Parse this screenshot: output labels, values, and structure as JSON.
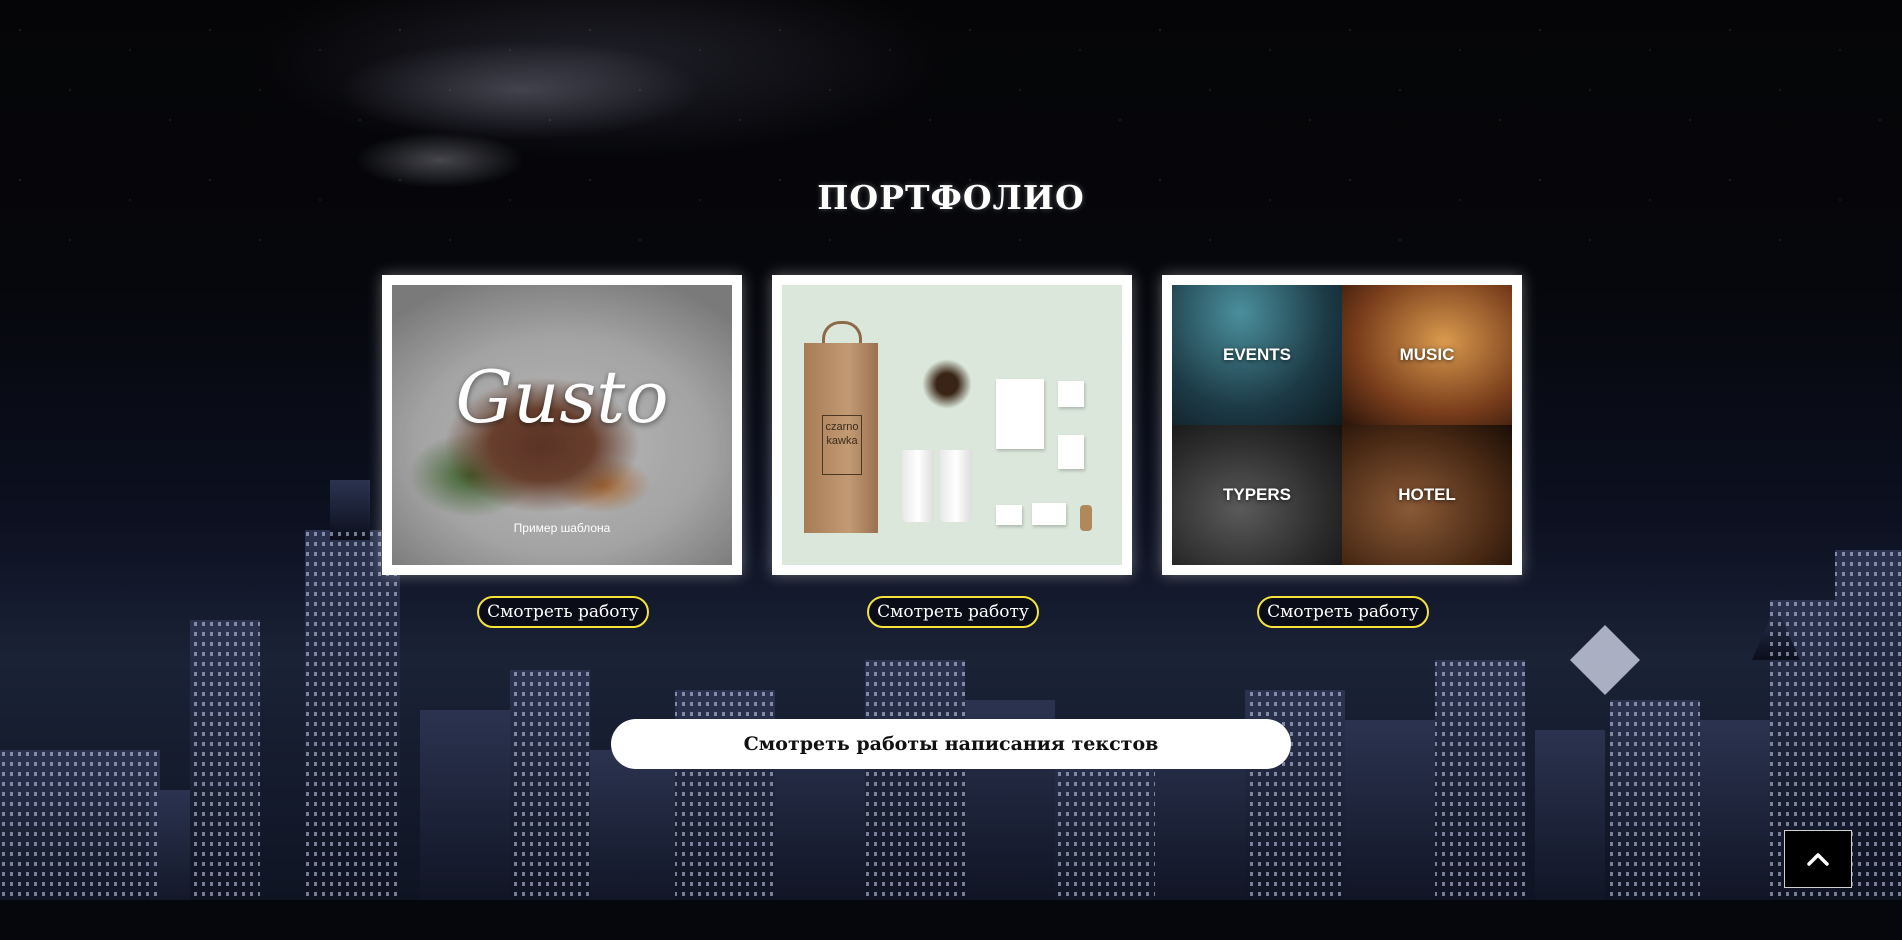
{
  "section": {
    "title": "ПОРТФОЛИО"
  },
  "portfolio": {
    "items": [
      {
        "thumbnail": "gusto-restaurant-template",
        "logo_text": "Gusto",
        "caption": "Пример шаблона",
        "button_label": "Смотреть работу"
      },
      {
        "thumbnail": "czarno-kawka-branding",
        "bag_label": "czarno kawka",
        "button_label": "Смотреть работу"
      },
      {
        "thumbnail": "events-music-typers-hotel-grid",
        "tiles": [
          "EVENTS",
          "MUSIC",
          "TYPERS",
          "HOTEL"
        ],
        "button_label": "Смотреть работу"
      }
    ]
  },
  "texts_button": {
    "label": "Смотреть работы написания текстов"
  },
  "scroll_top": {
    "icon": "chevron-up-icon"
  },
  "colors": {
    "accent_border": "#f5e23a",
    "title": "#ffffff",
    "pill_bg": "#ffffff"
  }
}
